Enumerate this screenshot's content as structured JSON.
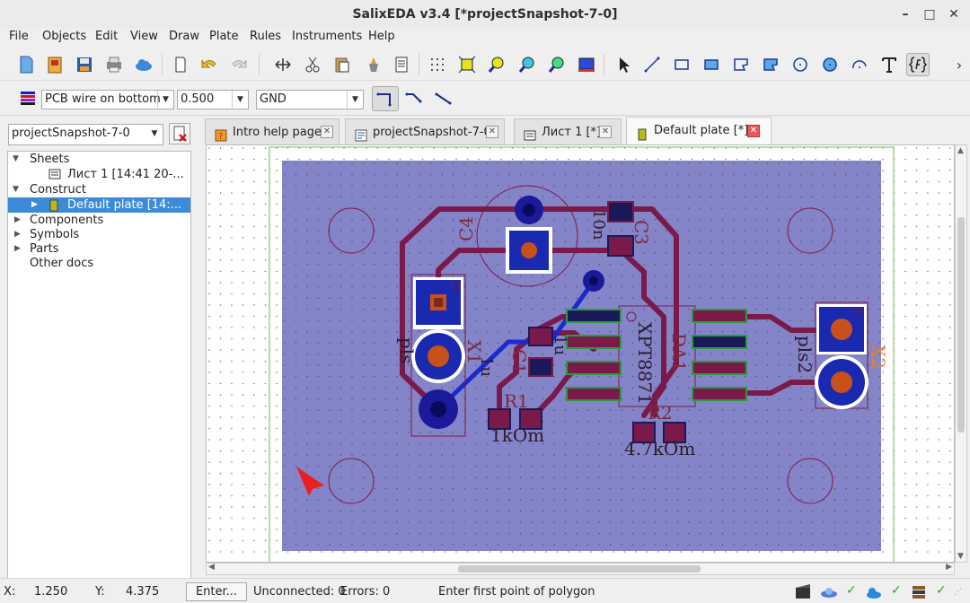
{
  "window": {
    "title": "SalixEDA v3.4 [*projectSnapshot-7-0]",
    "minimize": "–",
    "maximize": "□",
    "close": "✕"
  },
  "menu": [
    "File",
    "Objects",
    "Edit",
    "View",
    "Draw",
    "Plate",
    "Rules",
    "Instruments",
    "Help"
  ],
  "toolbar": {
    "icons": [
      "new-file-icon",
      "open-project-icon",
      "save-icon",
      "print-icon",
      "cloud-icon",
      "new-sheet-icon",
      "undo-icon",
      "redo-icon",
      "mirror-icon",
      "cut-icon",
      "paste-icon",
      "clean-icon",
      "properties-icon",
      "grid-icon",
      "zoom-fit-icon",
      "zoom-in-icon",
      "zoom-out-icon",
      "zoom-window-icon",
      "board-3d-icon",
      "select-icon",
      "line-icon",
      "rect-icon",
      "filled-rect-icon",
      "polygon-icon",
      "filled-polygon-icon",
      "circle-icon",
      "filled-circle-icon",
      "arc-icon",
      "text-icon",
      "field-icon"
    ],
    "more": "›"
  },
  "toolbar2": {
    "layer": "PCB wire on bottom",
    "width": "0.500",
    "net": "GND"
  },
  "project_selector": "projectSnapshot-7-0",
  "tree": {
    "sheets": "Sheets",
    "sheet1": "Лист 1 [14:41 20-...",
    "construct": "Construct",
    "default_plate": "Default plate [14:...",
    "components": "Components",
    "symbols": "Symbols",
    "parts": "Parts",
    "other_docs": "Other docs"
  },
  "tabs": [
    {
      "label": "Intro help page"
    },
    {
      "label": "projectSnapshot-7-0"
    },
    {
      "label": "Лист 1 [*]"
    },
    {
      "label": "Default plate [*]"
    }
  ],
  "pcb": {
    "labels": {
      "c4": "C4",
      "c3": "C3",
      "c3_val": "10n",
      "pls": "pls",
      "x1": "X1",
      "c1": "C1",
      "c1_val": "1u",
      "c1_val2": "1u",
      "r1": "R1",
      "r1_val": "1kOm",
      "da1": "DA1",
      "xpt": "XPT8871",
      "r2": "R2",
      "r2_val": "4.7kOm",
      "pls2": "pls2",
      "x2": "X2"
    },
    "colors": {
      "board": "#8484c8",
      "track": "#7a1a4a",
      "selected_track": "#1a2ad0",
      "pad": "#7a1a4a",
      "outline": "#2e9a3e"
    }
  },
  "status": {
    "x_label": "X:",
    "x_value": "1.250",
    "y_label": "Y:",
    "y_value": "4.375",
    "enter_button": "Enter...",
    "unconnected": "Unconnected: 0",
    "errors": "Errors: 0",
    "hint": "Enter first point of polygon"
  }
}
